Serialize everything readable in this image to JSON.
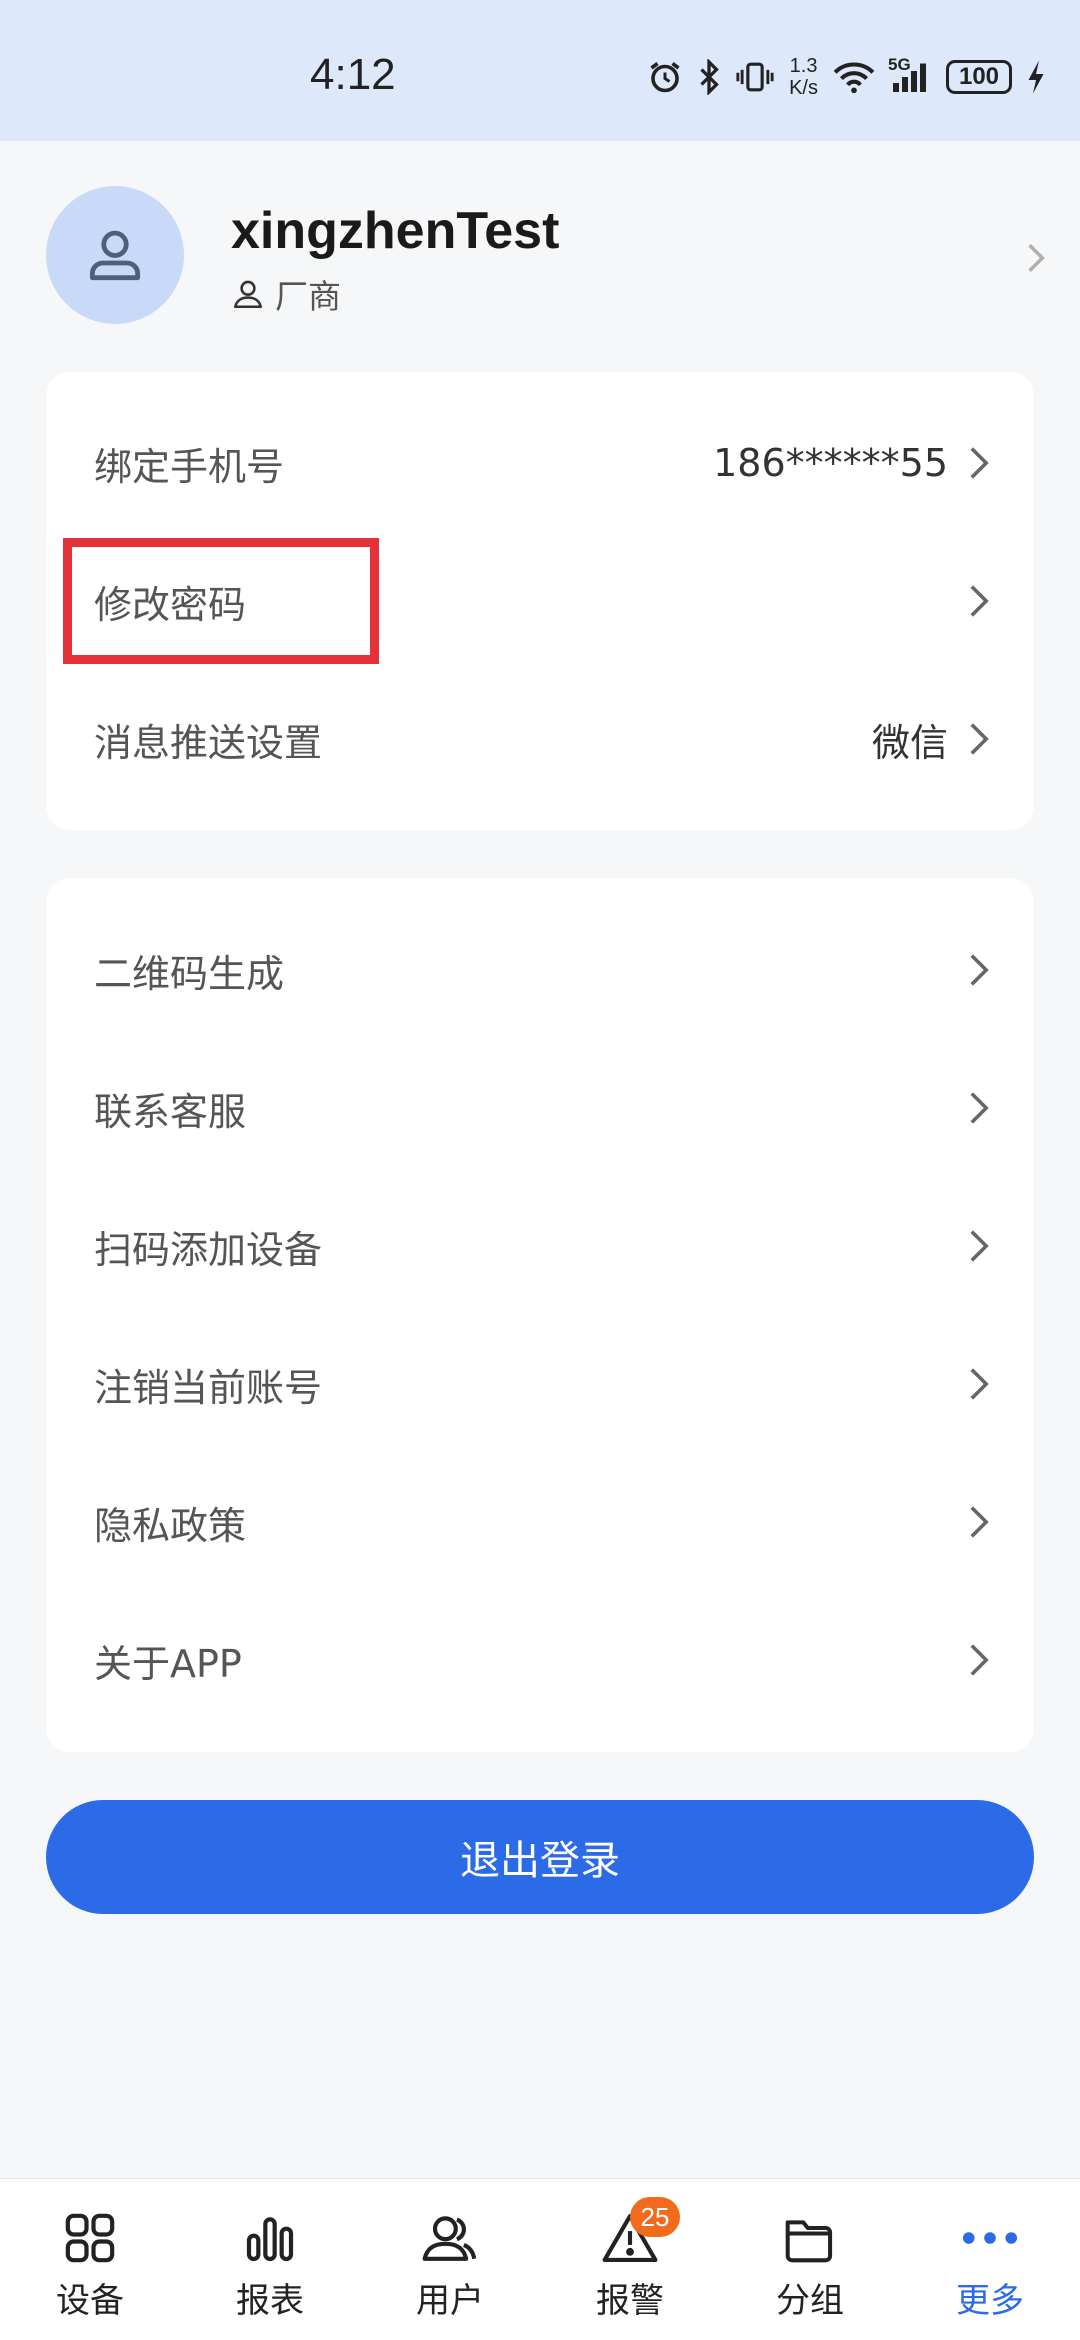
{
  "status_bar": {
    "time": "4:12",
    "net_speed_top": "1.3",
    "net_speed_bottom": "K/s",
    "network_type": "5G",
    "battery": "100",
    "icons": [
      "alarm-icon",
      "bluetooth-icon",
      "vibrate-icon",
      "wifi-icon",
      "signal-icon",
      "battery-icon",
      "charging-icon"
    ]
  },
  "profile": {
    "username": "xingzhenTest",
    "role": "厂商"
  },
  "account_section": {
    "items": [
      {
        "label": "绑定手机号",
        "value": "186******55"
      },
      {
        "label": "修改密码",
        "value": ""
      },
      {
        "label": "消息推送设置",
        "value": "微信"
      }
    ]
  },
  "general_section": {
    "items": [
      {
        "label": "二维码生成"
      },
      {
        "label": "联系客服"
      },
      {
        "label": "扫码添加设备"
      },
      {
        "label": "注销当前账号"
      },
      {
        "label": "隐私政策"
      },
      {
        "label": "关于APP"
      }
    ]
  },
  "logout_label": "退出登录",
  "bottom_nav": {
    "items": [
      {
        "label": "设备",
        "icon": "grid-icon"
      },
      {
        "label": "报表",
        "icon": "bar-chart-icon"
      },
      {
        "label": "用户",
        "icon": "users-icon"
      },
      {
        "label": "报警",
        "icon": "warning-icon",
        "badge": "25"
      },
      {
        "label": "分组",
        "icon": "folder-icon"
      },
      {
        "label": "更多",
        "icon": "more-icon",
        "active": true
      }
    ]
  },
  "colors": {
    "accent": "#2b6be8",
    "highlight_box": "#e53238",
    "badge": "#f26a1b",
    "status_bar_bg": "#dde8fb"
  }
}
